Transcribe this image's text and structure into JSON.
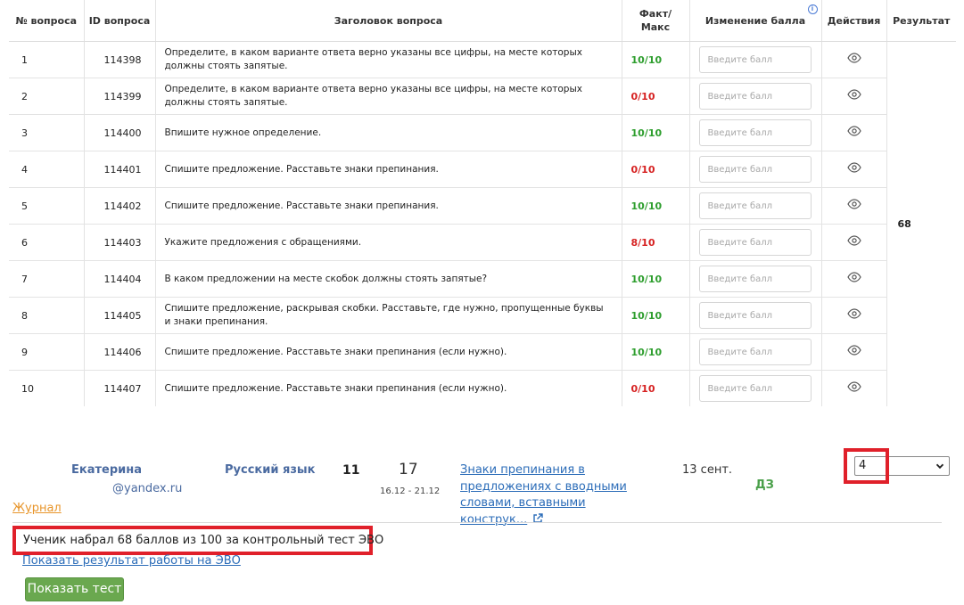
{
  "table": {
    "headers": {
      "num": "№ вопроса",
      "id": "ID вопроса",
      "title": "Заголовок вопроса",
      "fact": "Факт/ Макс",
      "change": "Изменение балла",
      "actions": "Действия",
      "result": "Результат"
    },
    "placeholder": "Введите балл",
    "result_value": "68",
    "rows": [
      {
        "num": "1",
        "id": "114398",
        "title": "Определите, в каком варианте ответа верно указаны все цифры, на месте которых должны стоять запятые.",
        "score": "10/10",
        "status": "correct"
      },
      {
        "num": "2",
        "id": "114399",
        "title": "Определите, в каком варианте ответа верно указаны все цифры, на месте которых должны стоять запятые.",
        "score": "0/10",
        "status": "wrong"
      },
      {
        "num": "3",
        "id": "114400",
        "title": "Впишите нужное определение.",
        "score": "10/10",
        "status": "correct"
      },
      {
        "num": "4",
        "id": "114401",
        "title": "Спишите предложение. Расставьте знаки препинания.",
        "score": "0/10",
        "status": "wrong"
      },
      {
        "num": "5",
        "id": "114402",
        "title": "Спишите предложение. Расставьте знаки препинания.",
        "score": "10/10",
        "status": "correct"
      },
      {
        "num": "6",
        "id": "114403",
        "title": "Укажите предложения с обращениями.",
        "score": "8/10",
        "status": "wrong"
      },
      {
        "num": "7",
        "id": "114404",
        "title": "В каком предложении на месте скобок должны стоять запятые?",
        "score": "10/10",
        "status": "correct"
      },
      {
        "num": "8",
        "id": "114405",
        "title": "Спишите предложение, раскрывая скобки. Расставьте, где нужно, пропущенные буквы и знаки препинания.",
        "score": "10/10",
        "status": "correct"
      },
      {
        "num": "9",
        "id": "114406",
        "title": "Спишите предложение. Расставьте знаки препинания (если нужно).",
        "score": "10/10",
        "status": "correct"
      },
      {
        "num": "10",
        "id": "114407",
        "title": "Спишите предложение. Расставьте знаки препинания (если нужно).",
        "score": "0/10",
        "status": "wrong"
      }
    ]
  },
  "entry": {
    "student_name": "Екатерина",
    "student_email": "@yandex.ru",
    "subject": "Русский язык",
    "grade_level": "11",
    "week": "17",
    "week_dates": "16.12 - 21.12",
    "topic": "Знаки препинания в предложениях с вводными словами, вставными конструк...",
    "date": "13 сент.",
    "type": "ДЗ",
    "mark_selected": "4"
  },
  "links": {
    "journal": "Журнал",
    "show_result": "Показать результат работы на ЭВО",
    "show_test": "Показать тест"
  },
  "summary": "Ученик набрал 68 баллов из 100 за контрольный тест ЭВО",
  "colors": {
    "correct": "#2e9e2e",
    "wrong": "#d62121",
    "highlight": "#e0202a",
    "button": "#6aa84f"
  }
}
